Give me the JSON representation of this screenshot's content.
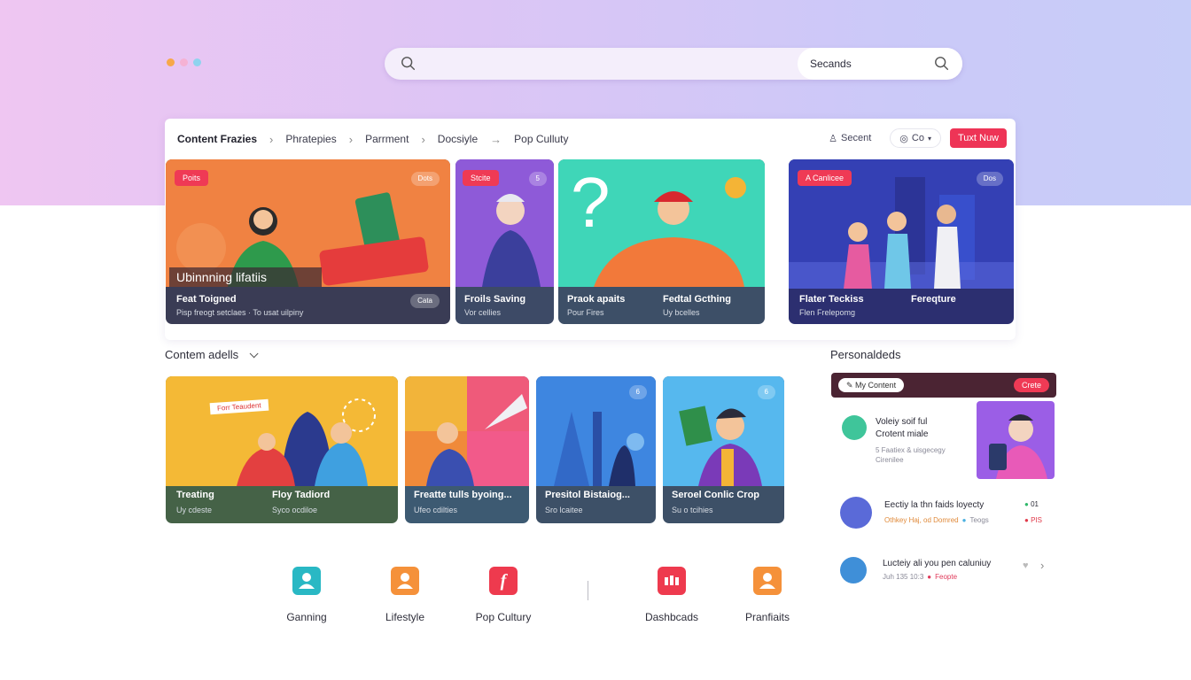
{
  "colors": {
    "accent_red": "#ef3a55",
    "teal": "#29b8c4",
    "orange": "#f5913a"
  },
  "search": {
    "value": "Secands"
  },
  "breadcrumb": [
    {
      "label": "Content Frazies"
    },
    {
      "label": "Phratepies"
    },
    {
      "label": "Parrment"
    },
    {
      "label": "Docsiyle"
    },
    {
      "label": "Pop Culluty"
    }
  ],
  "toolbar": {
    "recent_label": "Secent",
    "co_label": "Co",
    "action_label": "Tuxt Nuw"
  },
  "featured": [
    {
      "badge": "Poits",
      "pill": "Dots",
      "overlay": "Ubinnning lifatiis",
      "title": "Feat Toigned",
      "sub": "Pisp freogt setclaes · To usat uilpiny",
      "pill2": "Cata"
    },
    {
      "badge": "Stcite",
      "pill": "5",
      "title": "Froils Saving",
      "sub": "Vor cellies"
    },
    {
      "title": "Praok apaits",
      "sub": "Pour Fires",
      "title2": "Fedtal Gcthing",
      "sub2": "Uy bcelles"
    },
    {
      "badge": "A Canlicee",
      "pill": "Dos",
      "title": "Flater Teckiss",
      "sub": "Flen Frelepomg",
      "title2": "Fereqture"
    }
  ],
  "section_content": {
    "title": "Contem adells"
  },
  "grid_cards": [
    {
      "tag": "Forr Teaudent",
      "title": "Treating",
      "sub": "Uy cdeste",
      "title2": "Floy Tadiord",
      "sub2": "Syco ocdiloe"
    },
    {
      "title": "Freatte tulls byoing...",
      "sub": "Ufeo cdilties"
    },
    {
      "pill": "6",
      "title": "Presitol Bistaiog...",
      "sub": "Sro lcaitee"
    },
    {
      "pill": "6",
      "title": "Seroel Conlic Crop",
      "sub": "Su o tcihies"
    }
  ],
  "personalized": {
    "title": "Personaldeds",
    "header_label": "My Content",
    "header_action": "Crete",
    "items": [
      {
        "title": "Voleiy soif ful",
        "title_line2": "Crotent miale",
        "sub": "5 Faatiex & uisgecegy",
        "sub_line2": "Cirenilee"
      },
      {
        "title": "Eectiy la thn faids loyecty",
        "sub": "Othkey Haj, od Domred",
        "sub_tag": "Teogs",
        "count": "01",
        "count2": "PIS"
      },
      {
        "title": "Lucteiy ali you pen caluniuy",
        "sub": "Juh 135 10:3",
        "sub_tag": "Feopte"
      }
    ]
  },
  "categories": [
    {
      "label": "Ganning",
      "icon": "user-icon",
      "color": "#29b8c4"
    },
    {
      "label": "Lifestyle",
      "icon": "user-icon",
      "color": "#f5913a"
    },
    {
      "label": "Pop Cultury",
      "icon": "f-letter-icon",
      "color": "#ee3a4e"
    },
    {
      "label": "Dashbcads",
      "icon": "dashboard-icon",
      "color": "#ee3a4e"
    },
    {
      "label": "Pranfiaits",
      "icon": "user-icon",
      "color": "#f5913a"
    }
  ]
}
